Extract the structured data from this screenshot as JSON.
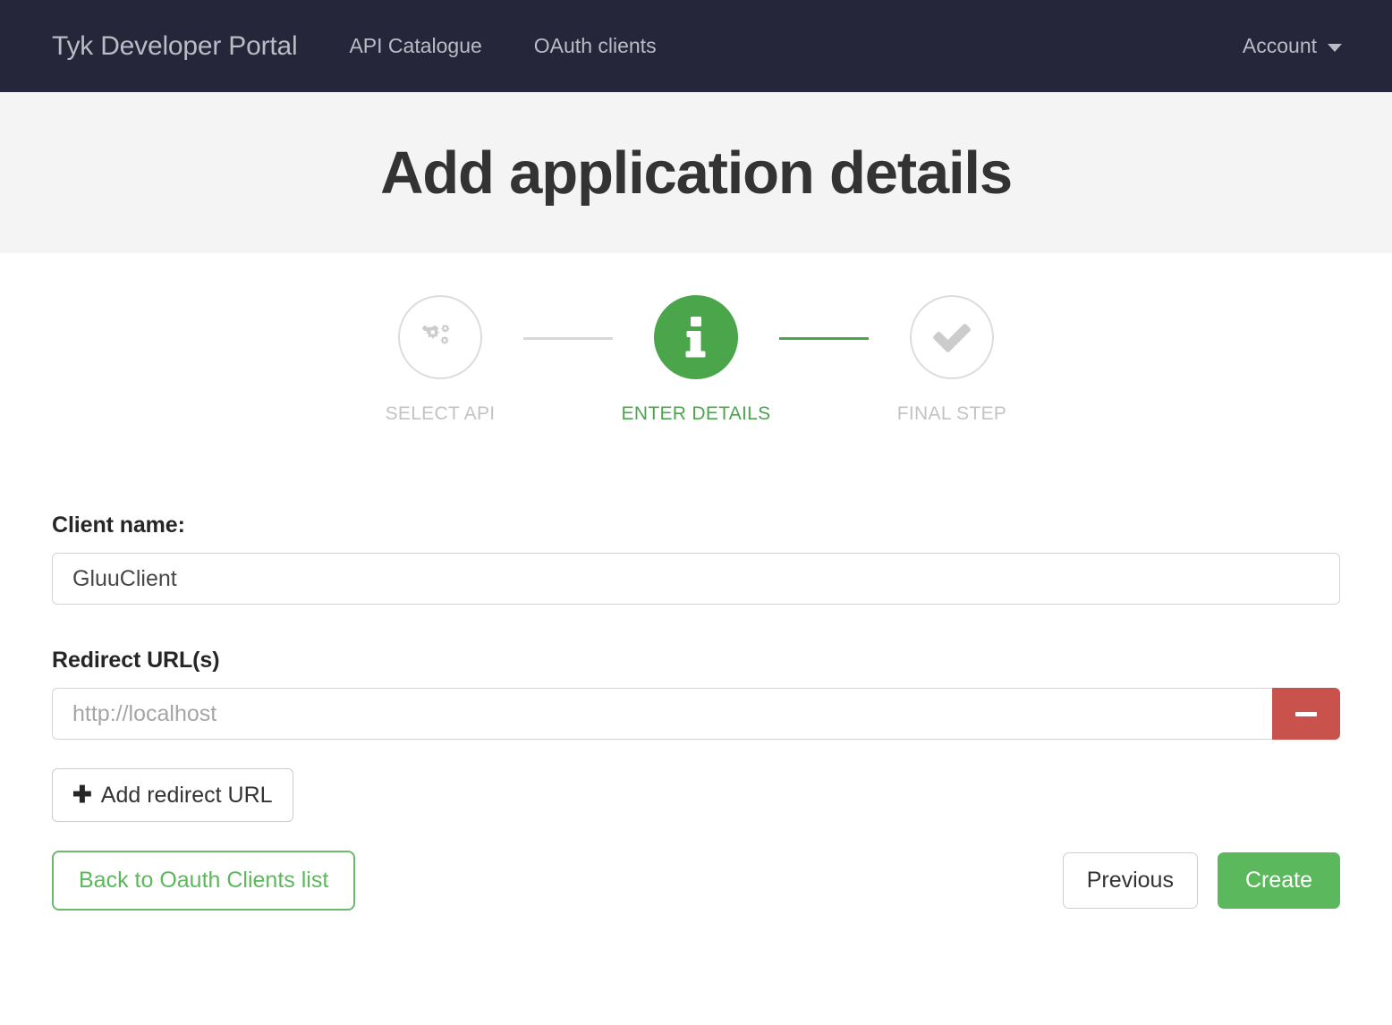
{
  "navbar": {
    "brand": "Tyk Developer Portal",
    "links": [
      {
        "label": "API Catalogue",
        "name": "nav-link-api-catalogue"
      },
      {
        "label": "OAuth clients",
        "name": "nav-link-oauth-clients"
      }
    ],
    "account": {
      "label": "Account",
      "icon": "caret-down-icon"
    },
    "colors": {
      "background": "#25263a",
      "text": "#b9bcc4"
    }
  },
  "header": {
    "title": "Add application details",
    "background": "#f4f4f4"
  },
  "wizard": {
    "active_color": "#4ba64b",
    "inactive_color": "#c3c3c3",
    "steps": [
      {
        "label": "SELECT API",
        "icon": "cogs-icon",
        "state": "inactive"
      },
      {
        "label": "ENTER DETAILS",
        "icon": "info-icon",
        "state": "active"
      },
      {
        "label": "FINAL STEP",
        "icon": "check-icon",
        "state": "inactive"
      }
    ],
    "connectors": [
      {
        "state": "inactive",
        "color": "#d8d8d8"
      },
      {
        "state": "done",
        "color": "#4ba64b"
      }
    ]
  },
  "form": {
    "client_name": {
      "label": "Client name:",
      "value": "GluuClient",
      "placeholder": ""
    },
    "redirect_urls": {
      "label": "Redirect URL(s)",
      "rows": [
        {
          "value": "",
          "placeholder": "http://localhost",
          "remove_icon": "minus-icon"
        }
      ],
      "add_button": {
        "label": "Add redirect URL",
        "icon": "plus-icon"
      }
    }
  },
  "actions": {
    "back": {
      "label": "Back to Oauth Clients list",
      "color": "#5cb85c"
    },
    "previous": {
      "label": "Previous"
    },
    "create": {
      "label": "Create",
      "color": "#5cb85c"
    }
  }
}
